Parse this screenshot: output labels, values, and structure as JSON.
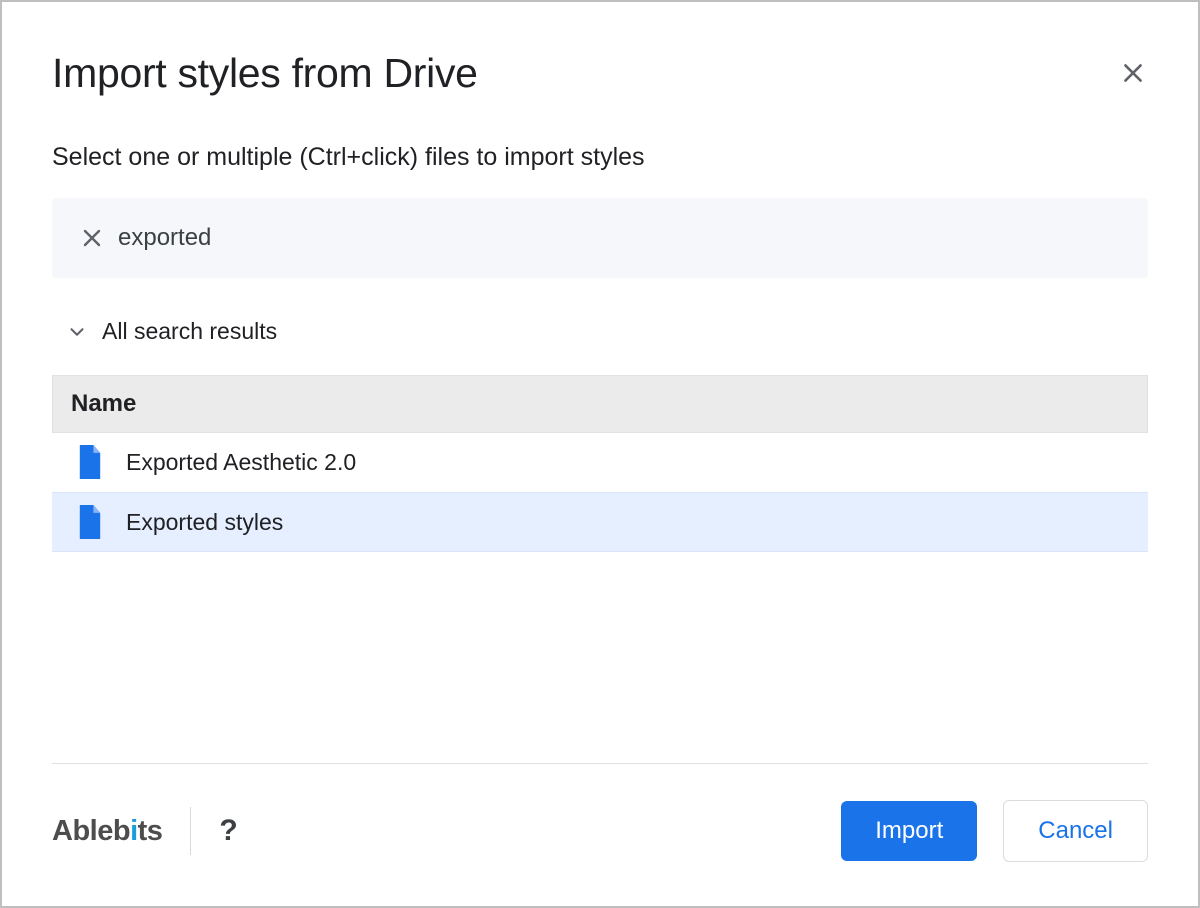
{
  "dialog": {
    "title": "Import styles from Drive",
    "subtitle": "Select one or multiple (Ctrl+click) files to import styles"
  },
  "search": {
    "value": "exported",
    "results_label": "All search results"
  },
  "table": {
    "column_header": "Name",
    "rows": [
      {
        "name": "Exported Aesthetic 2.0",
        "selected": false
      },
      {
        "name": "Exported styles",
        "selected": true
      }
    ]
  },
  "footer": {
    "brand": "Ablebits",
    "help": "?",
    "import_label": "Import",
    "cancel_label": "Cancel"
  },
  "icons": {
    "doc_color": "#1a73e8"
  }
}
